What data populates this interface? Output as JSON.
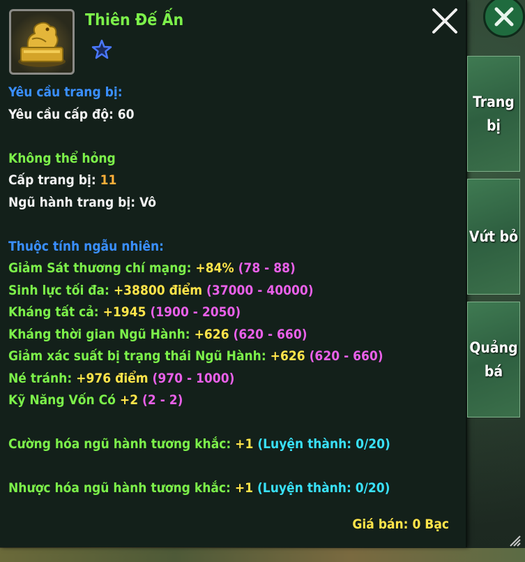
{
  "item": {
    "name": "Thiên Đế Ấn",
    "icon": "golden-seal-icon",
    "star_icon": "star-outline-icon"
  },
  "requirements": {
    "heading": "Yêu cầu trang bị:",
    "level_label": "Yêu cầu cấp độ: 60"
  },
  "info": {
    "unbreakable": "Không thể hỏng",
    "equip_level_label": "Cấp trang bị:",
    "equip_level_value": "11",
    "element": "Ngũ hành trang bị: Vô"
  },
  "random_attrs": {
    "heading": "Thuộc tính ngẫu nhiên:",
    "items": [
      {
        "label": "Giảm Sát thương chí mạng:",
        "value": "+84%",
        "range": "(78 - 88)"
      },
      {
        "label": "Sinh lực tối đa:",
        "value": "+38800 điểm",
        "range": "(37000 - 40000)"
      },
      {
        "label": "Kháng tất cả:",
        "value": "+1945",
        "range": "(1900 - 2050)"
      },
      {
        "label": "Kháng thời gian Ngũ Hành:",
        "value": "+626",
        "range": "(620 - 660)"
      },
      {
        "label": "Giảm xác suất bị trạng thái Ngũ Hành:",
        "value": "+626",
        "range": "(620 - 660)"
      },
      {
        "label": "Né tránh:",
        "value": "+976 điểm",
        "range": "(970 - 1000)"
      },
      {
        "label": "Kỹ Năng Vốn Có",
        "value": "+2",
        "range": "(2 - 2)"
      }
    ]
  },
  "element_bonus": [
    {
      "label": "Cường hóa ngũ hành tương khắc:",
      "value": "+1",
      "note": "(Luyện thành: 0/20)"
    },
    {
      "label": "Nhược hóa ngũ hành tương khắc:",
      "value": "+1",
      "note": "(Luyện thành: 0/20)"
    }
  ],
  "price": "Giá bán: 0 Bạc",
  "actions": {
    "equip": "Trang bị",
    "discard": "Vứt bỏ",
    "promote_line1": "Quảng",
    "promote_line2": "bá"
  },
  "colors": {
    "heading_blue": "#3a8fff",
    "attr_green": "#7cf04a",
    "value_yellow": "#ffe44a",
    "range_magenta": "#e860e8",
    "note_cyan": "#39e0f8",
    "level_orange": "#ffb03a"
  }
}
